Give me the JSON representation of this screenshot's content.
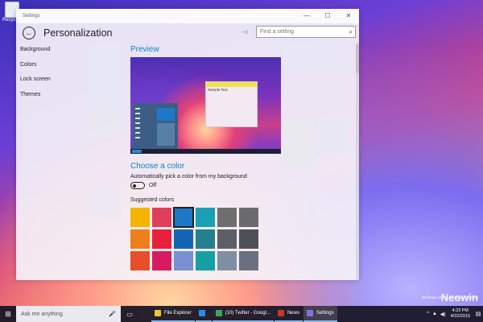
{
  "desktop": {
    "recycle_label": "Recycle Bin",
    "watermark": "Neowin",
    "build_text": "Windows 10 Pro Technical Preview"
  },
  "window": {
    "title": "Settings",
    "min_glyph": "—",
    "max_glyph": "☐",
    "close_glyph": "✕",
    "page_title": "Personalization",
    "back_glyph": "←",
    "pin_glyph": "⊣",
    "search_placeholder": "Find a setting",
    "search_glyph": "⌕"
  },
  "nav": {
    "items": [
      {
        "label": "Background"
      },
      {
        "label": "Colors"
      },
      {
        "label": "Lock screen"
      },
      {
        "label": "Themes"
      }
    ]
  },
  "content": {
    "preview_title": "Preview",
    "sample_text": "Sample Text",
    "choose_title": "Choose a color",
    "auto_label": "Automatically pick a color from my background",
    "toggle_state": "Off",
    "suggested_label": "Suggested colors",
    "swatches": [
      "#f4b400",
      "#e03e5a",
      "#1e78c8",
      "#1a9fb5",
      "#6e6e6e",
      "#6b6b6f",
      "#ef7f1a",
      "#e8203e",
      "#1464b4",
      "#247f8f",
      "#5c5f66",
      "#4e5058",
      "#e84d2c",
      "#d81b60",
      "#7a8fd0",
      "#16a0a6",
      "#7f8fa2",
      "#6a7080"
    ],
    "selected_index": 2
  },
  "taskbar": {
    "start_glyph": "⊞",
    "search_placeholder": "Ask me anything",
    "mic_glyph": "🎤",
    "taskview_glyph": "▭",
    "apps": [
      {
        "label": "File Explorer",
        "color": "#f0c040",
        "active": false
      },
      {
        "label": "",
        "color": "#2c8ee0",
        "active": false
      },
      {
        "label": "(10) Twitter - Googl...",
        "color": "#3ba55c",
        "active": false
      },
      {
        "label": "News",
        "color": "#c0392b",
        "active": false
      },
      {
        "label": "Settings",
        "color": "#8a6ee0",
        "active": true
      }
    ],
    "tray_up": "^",
    "tray_net": "▲",
    "tray_vol": "◀)",
    "time": "4:23 PM",
    "date": "4/22/2015",
    "notify_glyph": "▤"
  },
  "colors": {
    "accent": "#0a8ab8"
  }
}
